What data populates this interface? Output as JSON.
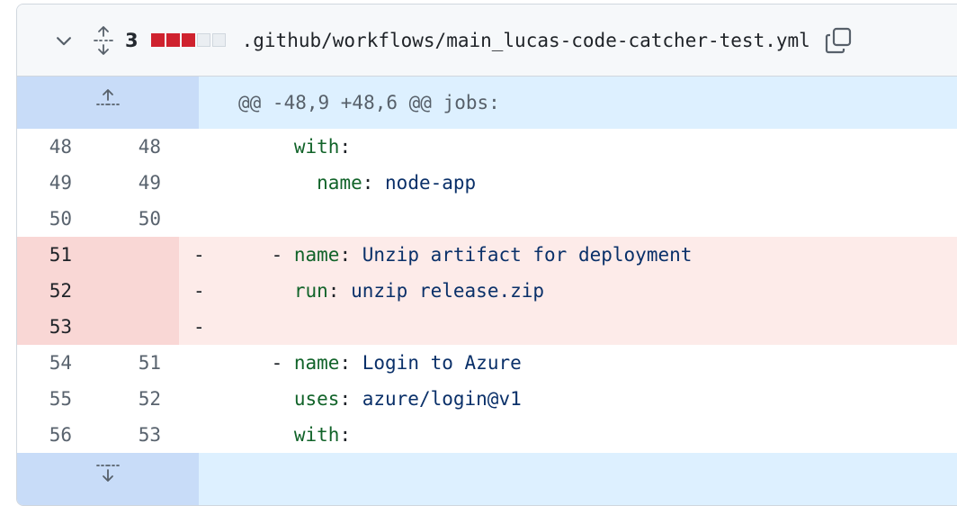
{
  "file": {
    "change_count": "3",
    "diffstat": [
      "deleted",
      "deleted",
      "deleted",
      "neutral",
      "neutral"
    ],
    "path": ".github/workflows/main_lucas-code-catcher-test.yml"
  },
  "hunk": {
    "header": "@@ -48,9 +48,6 @@ jobs:"
  },
  "lines": [
    {
      "old": "48",
      "new": "48",
      "type": "context",
      "marker": "",
      "indent": "      ",
      "dash": "",
      "key": "with",
      "colon": ":",
      "value": ""
    },
    {
      "old": "49",
      "new": "49",
      "type": "context",
      "marker": "",
      "indent": "        ",
      "dash": "",
      "key": "name",
      "colon": ":",
      "value": " node-app"
    },
    {
      "old": "50",
      "new": "50",
      "type": "context",
      "marker": "",
      "indent": "",
      "dash": "",
      "key": "",
      "colon": "",
      "value": ""
    },
    {
      "old": "51",
      "new": "",
      "type": "deleted",
      "marker": "-",
      "indent": "    ",
      "dash": "- ",
      "key": "name",
      "colon": ":",
      "value": " Unzip artifact for deployment"
    },
    {
      "old": "52",
      "new": "",
      "type": "deleted",
      "marker": "-",
      "indent": "      ",
      "dash": "",
      "key": "run",
      "colon": ":",
      "value": " unzip release.zip"
    },
    {
      "old": "53",
      "new": "",
      "type": "deleted",
      "marker": "-",
      "indent": "",
      "dash": "",
      "key": "",
      "colon": "",
      "value": ""
    },
    {
      "old": "54",
      "new": "51",
      "type": "context",
      "marker": "",
      "indent": "    ",
      "dash": "- ",
      "key": "name",
      "colon": ":",
      "value": " Login to Azure"
    },
    {
      "old": "55",
      "new": "52",
      "type": "context",
      "marker": "",
      "indent": "      ",
      "dash": "",
      "key": "uses",
      "colon": ":",
      "value": " azure/login@v1"
    },
    {
      "old": "56",
      "new": "53",
      "type": "context",
      "marker": "",
      "indent": "      ",
      "dash": "",
      "key": "with",
      "colon": ":",
      "value": ""
    }
  ],
  "colors": {
    "deleted_gutter": "#f9d7d5",
    "deleted_line": "#fdebe9",
    "hunk_bg": "#ddf0ff",
    "expander_bg": "#c8dcf8",
    "key": "#116329",
    "value": "#0a3069"
  },
  "icons": {
    "collapse": "chevron-down-icon",
    "expand_all": "unfold-icon",
    "copy": "copy-icon",
    "expand_up": "expand-up-icon",
    "expand_down": "expand-down-icon"
  }
}
